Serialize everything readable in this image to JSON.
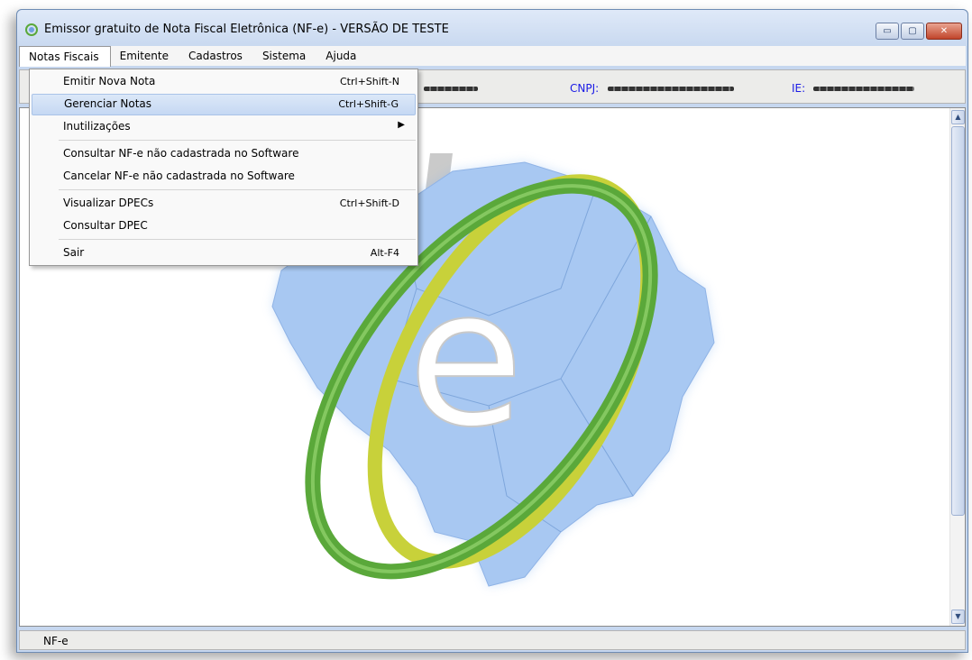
{
  "window": {
    "title": "Emissor gratuito de Nota Fiscal Eletrônica (NF-e) - VERSÃO DE TESTE",
    "minimize_glyph": "▭",
    "maximize_glyph": "▢",
    "close_glyph": "✕"
  },
  "menubar": {
    "items": [
      {
        "label": "Notas Fiscais"
      },
      {
        "label": "Emitente"
      },
      {
        "label": "Cadastros"
      },
      {
        "label": "Sistema"
      },
      {
        "label": "Ajuda"
      }
    ]
  },
  "infobar": {
    "cnpj_label": "CNPJ:",
    "ie_label": "IE:"
  },
  "dropdown": {
    "items": [
      {
        "label": "Emitir Nova Nota",
        "shortcut": "Ctrl+Shift-N"
      },
      {
        "label": "Gerenciar Notas",
        "shortcut": "Ctrl+Shift-G"
      },
      {
        "label": "Inutilizações",
        "shortcut": ""
      },
      {
        "label": "Consultar NF-e não cadastrada no Software",
        "shortcut": ""
      },
      {
        "label": "Cancelar NF-e não cadastrada no Software",
        "shortcut": ""
      },
      {
        "label": "Visualizar DPECs",
        "shortcut": "Ctrl+Shift-D"
      },
      {
        "label": "Consultar DPEC",
        "shortcut": ""
      },
      {
        "label": "Sair",
        "shortcut": "Alt-F4"
      }
    ],
    "submenu_arrow": "▶"
  },
  "scrollbar": {
    "up_glyph": "▲",
    "down_glyph": "▼"
  },
  "statusbar": {
    "text": "NF-e"
  },
  "logo": {
    "letter": "e"
  },
  "colors": {
    "map": "#a8c8f2",
    "ring_green": "#5aa83a",
    "ring_yellow": "#c8d13a",
    "highlight": "#c5d8f3"
  }
}
